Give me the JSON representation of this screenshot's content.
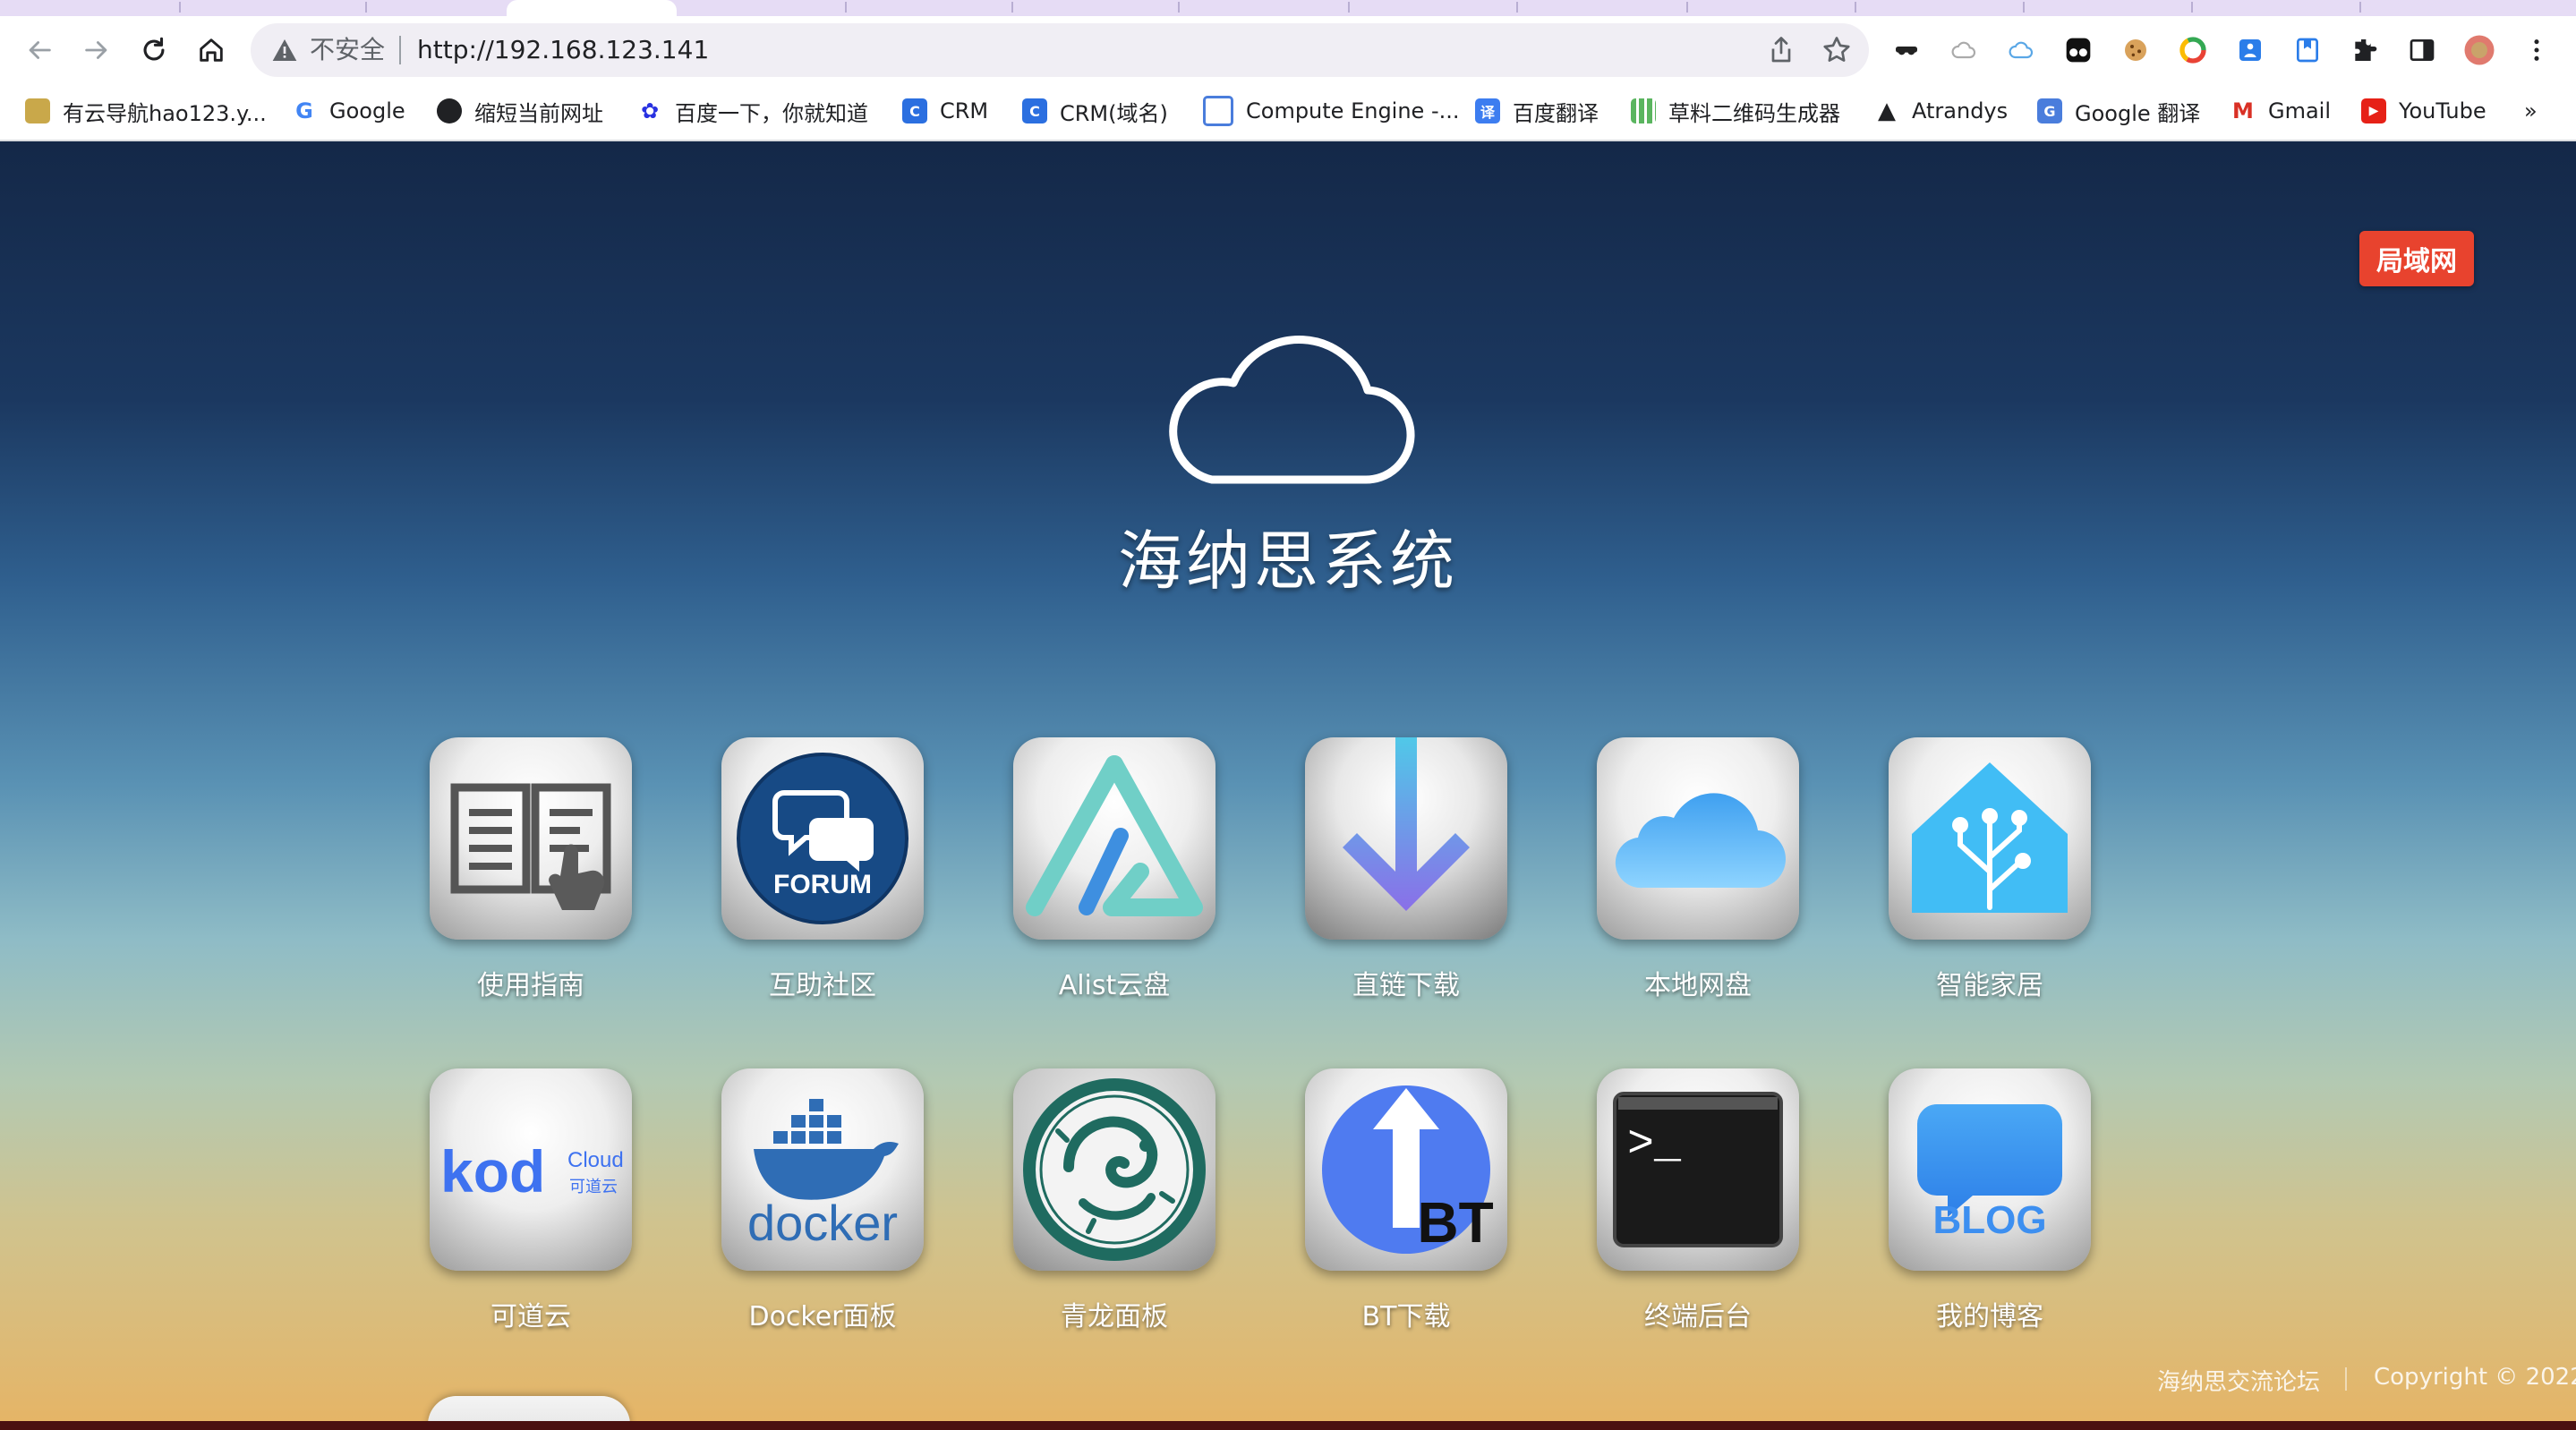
{
  "browser": {
    "insecure_label": "不安全",
    "url": "http://192.168.123.141",
    "bookmarks": [
      {
        "label": "有云导航hao123.y...",
        "icon": "hao123-icon"
      },
      {
        "label": "Google",
        "icon": "google-icon"
      },
      {
        "label": "缩短当前网址",
        "icon": "globe-icon"
      },
      {
        "label": "百度一下，你就知道",
        "icon": "baidu-icon"
      },
      {
        "label": "CRM",
        "icon": "crm-icon"
      },
      {
        "label": "CRM(域名)",
        "icon": "crm-icon"
      },
      {
        "label": "Compute Engine -...",
        "icon": "compute-engine-icon"
      },
      {
        "label": "百度翻译",
        "icon": "baidu-translate-icon"
      },
      {
        "label": "草料二维码生成器",
        "icon": "qrcode-icon"
      },
      {
        "label": "Atrandys",
        "icon": "atrandys-icon"
      },
      {
        "label": "Google 翻译",
        "icon": "google-translate-icon"
      },
      {
        "label": "Gmail",
        "icon": "gmail-icon"
      },
      {
        "label": "YouTube",
        "icon": "youtube-icon"
      }
    ],
    "more_bookmarks": "»"
  },
  "page": {
    "badge": "局域网",
    "title": "海纳思系统",
    "apps": [
      {
        "label": "使用指南",
        "icon": "book-guide-icon"
      },
      {
        "label": "互助社区",
        "icon": "forum-icon",
        "icon_text": "FORUM"
      },
      {
        "label": "Alist云盘",
        "icon": "alist-icon"
      },
      {
        "label": "直链下载",
        "icon": "download-arrow-icon"
      },
      {
        "label": "本地网盘",
        "icon": "icloud-icon"
      },
      {
        "label": "智能家居",
        "icon": "home-assistant-icon"
      },
      {
        "label": "可道云",
        "icon": "kodcloud-icon",
        "icon_text": "kod",
        "icon_text2": "Cloud",
        "icon_text3": "可道云"
      },
      {
        "label": "Docker面板",
        "icon": "docker-icon",
        "icon_text": "docker"
      },
      {
        "label": "青龙面板",
        "icon": "qinglong-dragon-icon"
      },
      {
        "label": "BT下载",
        "icon": "bt-download-icon",
        "icon_text": "BT"
      },
      {
        "label": "终端后台",
        "icon": "terminal-icon",
        "icon_text": ">_"
      },
      {
        "label": "我的博客",
        "icon": "blog-icon",
        "icon_text": "BLOG"
      }
    ],
    "footer": {
      "forum_link": "海纳思交流论坛",
      "copyright": "Copyright © 2022"
    }
  },
  "colors": {
    "badge_bg": "#e8432e",
    "gradient_top": "#142848",
    "gradient_bottom": "#e6b465",
    "forum_blue": "#174a85",
    "docker_blue": "#2f6db5",
    "alist_teal": "#70cfc7",
    "bt_blue": "#4f7bf0"
  }
}
